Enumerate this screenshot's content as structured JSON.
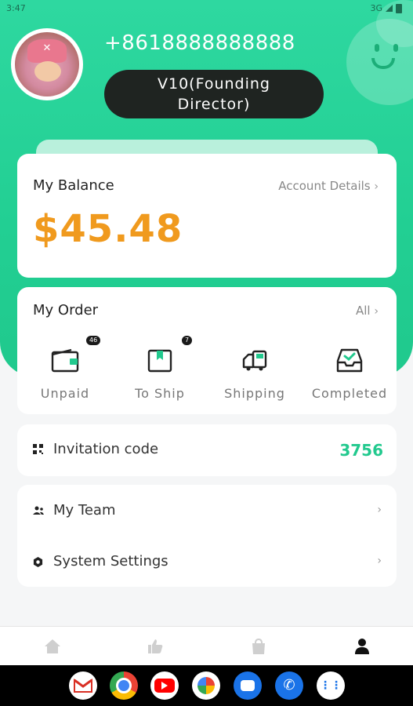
{
  "status_bar": {
    "time": "3:47",
    "network": "3G"
  },
  "profile": {
    "phone": "+8618888888888",
    "level_line1": "V10(Founding",
    "level_line2": "Director)"
  },
  "balance": {
    "title": "My Balance",
    "account_link": "Account Details",
    "amount": "$45.48"
  },
  "orders": {
    "title": "My Order",
    "all_link": "All",
    "items": [
      {
        "label": "Unpaid",
        "badge": "46",
        "icon": "wallet-icon"
      },
      {
        "label": "To Ship",
        "badge": "7",
        "icon": "package-icon"
      },
      {
        "label": "Shipping",
        "badge": "",
        "icon": "truck-icon"
      },
      {
        "label": "Completed",
        "badge": "",
        "icon": "inbox-check-icon"
      }
    ]
  },
  "invitation": {
    "label": "Invitation code",
    "code": "3756",
    "icon": "qr-icon"
  },
  "menu": {
    "items": [
      {
        "label": "My Team",
        "icon": "team-icon"
      },
      {
        "label": "System Settings",
        "icon": "settings-icon"
      }
    ]
  },
  "tabbar": {
    "tabs": [
      "home-icon",
      "thumbs-up-icon",
      "bag-icon",
      "profile-icon"
    ],
    "active_index": 3
  },
  "dock": {
    "apps": [
      "gmail-icon",
      "chrome-icon",
      "youtube-icon",
      "photos-icon",
      "messages-icon",
      "phone-icon",
      "apps-icon"
    ]
  },
  "colors": {
    "accent": "#22c98e",
    "amount": "#f09a1e",
    "pill": "#1f2421"
  }
}
